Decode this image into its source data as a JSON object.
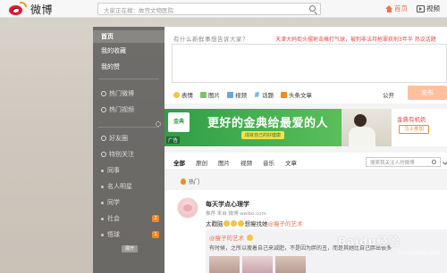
{
  "header": {
    "brand": "微博",
    "search_placeholder": "大家正在搜：故宫文物医院",
    "nav": [
      {
        "label": "首页",
        "icon": "home-icon",
        "active": true
      },
      {
        "label": "视频",
        "icon": "video-icon",
        "active": false
      }
    ]
  },
  "sidebar": {
    "items": [
      {
        "label": "首页",
        "active": true
      },
      {
        "label": "我的收藏"
      },
      {
        "label": "我的赞"
      },
      {
        "label": "热门微博",
        "icon": "hot-icon"
      },
      {
        "label": "热门视频",
        "icon": "video-icon"
      },
      {
        "label": "好友圈",
        "icon": "friends-icon"
      },
      {
        "label": "特别关注",
        "icon": "star-icon"
      },
      {
        "label": "同事"
      },
      {
        "label": "名人明星"
      },
      {
        "label": "同学"
      },
      {
        "label": "社会",
        "badge": "2"
      },
      {
        "label": "悟球",
        "badge": "1"
      }
    ],
    "expand_label": "展开"
  },
  "composer": {
    "hint": "有什么新鲜事想告诉大家？",
    "hot_topic": "天津大妈街头摆射击摊打气球，被判非法持枪罪获刑3年半 热议话题",
    "tools": [
      {
        "label": "表情",
        "icon": "emoji-icon"
      },
      {
        "label": "图片",
        "icon": "picture-icon"
      },
      {
        "label": "视频",
        "icon": "video-icon"
      },
      {
        "label": "话题",
        "icon": "topic-icon"
      },
      {
        "label": "头条文章",
        "icon": "article-icon"
      }
    ],
    "visibility": "公开",
    "send_label": "发布"
  },
  "ad": {
    "logo": "金典",
    "title": "更好的金典给最爱的人",
    "subtitle": "成就自己的好健康",
    "tag": "广告",
    "brand": "金典有机奶",
    "follow": "马上参加"
  },
  "feed_tabs": {
    "tabs": [
      "全部",
      "原创",
      "图片",
      "视频",
      "音乐",
      "文章"
    ],
    "search_placeholder": "搜索我关注人的微博"
  },
  "hot_label": "热门",
  "post": {
    "author": "每天学点心理学",
    "meta": "推荐 来自 微博 weibo.com",
    "text_prefix": "太戳脑",
    "text_mid": "想瘦找她",
    "text_link": "@瘦子的艺术",
    "quote_title": "@瘦子的艺术",
    "quote_text": "有时候，之所以瘦着自己来减肥，不是因为胖的丑，而是其她比自己胖出很多"
  },
  "watermark": {
    "text": "Baidu经验",
    "url": "jingyan.baidu.com"
  },
  "colors": {
    "accent": "#eb7350",
    "hot_red": "#e94545",
    "brand_green": "#2f9e47"
  }
}
